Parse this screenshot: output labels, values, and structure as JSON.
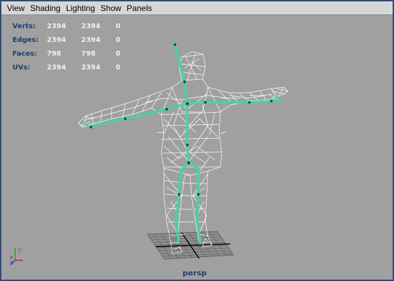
{
  "menu": {
    "items": [
      "View",
      "Shading",
      "Lighting",
      "Show",
      "Panels"
    ]
  },
  "hud": {
    "rows": [
      {
        "label": "Verts:",
        "v1": "2394",
        "v2": "2394",
        "v3": "0"
      },
      {
        "label": "Edges:",
        "v1": "2394",
        "v2": "2394",
        "v3": "0"
      },
      {
        "label": "Faces:",
        "v1": "798",
        "v2": "798",
        "v3": "0"
      },
      {
        "label": "UVs:",
        "v1": "2394",
        "v2": "2394",
        "v3": "0"
      }
    ]
  },
  "camera_label": "persp",
  "axis": {
    "x": "x",
    "y": "y",
    "z": "z"
  },
  "colors": {
    "viewport_bg": "#a0a0a0",
    "wireframe": "#ffffff",
    "skeleton": "#3fd6a6",
    "hud_label": "#1c3f6e",
    "menubar": "#d6d6d6"
  },
  "icons": [
    "axis-gizmo-icon",
    "ground-grid-icon"
  ]
}
